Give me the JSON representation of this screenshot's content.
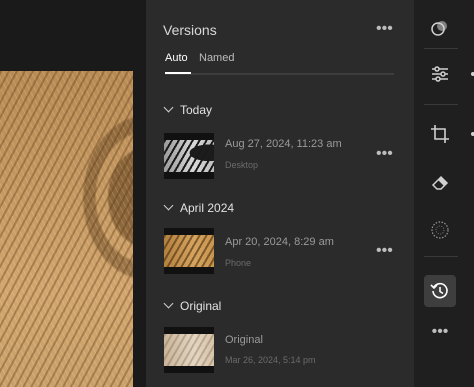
{
  "panel": {
    "title": "Versions",
    "tabs": [
      {
        "label": "Auto",
        "active": true
      },
      {
        "label": "Named",
        "active": false
      }
    ]
  },
  "sections": [
    {
      "header": "Today",
      "versions": [
        {
          "date": "Aug 27, 2024, 11:23 am",
          "source": "Desktop",
          "thumbnail_tone": "monochrome"
        }
      ]
    },
    {
      "header": "April 2024",
      "versions": [
        {
          "date": "Apr 20, 2024, 8:29 am",
          "source": "Phone",
          "thumbnail_tone": "warm"
        }
      ]
    },
    {
      "header": "Original",
      "versions": [
        {
          "date": "Original",
          "source": "Mar 26, 2024, 5:14 pm",
          "thumbnail_tone": "faded"
        }
      ]
    }
  ],
  "toolbar": {
    "tools": [
      {
        "icon": "presets-icon",
        "active": false
      },
      {
        "icon": "edit-sliders-icon",
        "active": false
      },
      {
        "icon": "crop-icon",
        "active": false
      },
      {
        "icon": "eraser-icon",
        "active": false
      },
      {
        "icon": "masking-icon",
        "active": false
      },
      {
        "icon": "versions-history-icon",
        "active": true
      },
      {
        "icon": "more-icon",
        "active": false
      }
    ]
  },
  "more_glyph": "•••",
  "colors": {
    "panel_bg": "#2b2b2b",
    "toolbar_bg": "#1f1f1f",
    "active_tool_bg": "#3e3e3e",
    "text_primary": "#e2e2e2",
    "text_secondary": "#9a9a9a"
  }
}
